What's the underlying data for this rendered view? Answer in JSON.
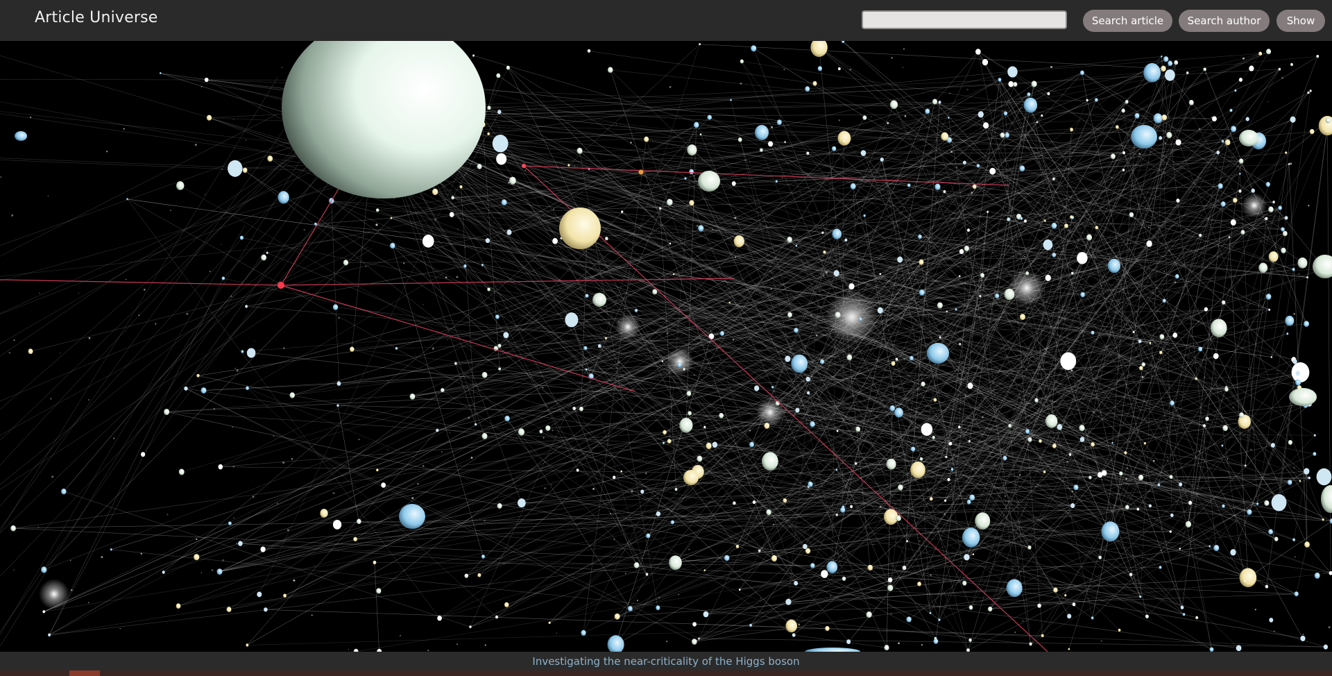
{
  "header": {
    "title": "Article Universe",
    "search": {
      "value": "",
      "placeholder": ""
    },
    "buttons": {
      "search_article": "Search article",
      "search_author": "Search author",
      "show": "Show"
    }
  },
  "footer": {
    "selected_article": "Investigating the near-criticality of the Higgs boson"
  },
  "colors": {
    "bar": "#2a2a2a",
    "button": "#847c7c",
    "selected_link": "#e0405f",
    "footer_text": "#8fb1c8"
  }
}
